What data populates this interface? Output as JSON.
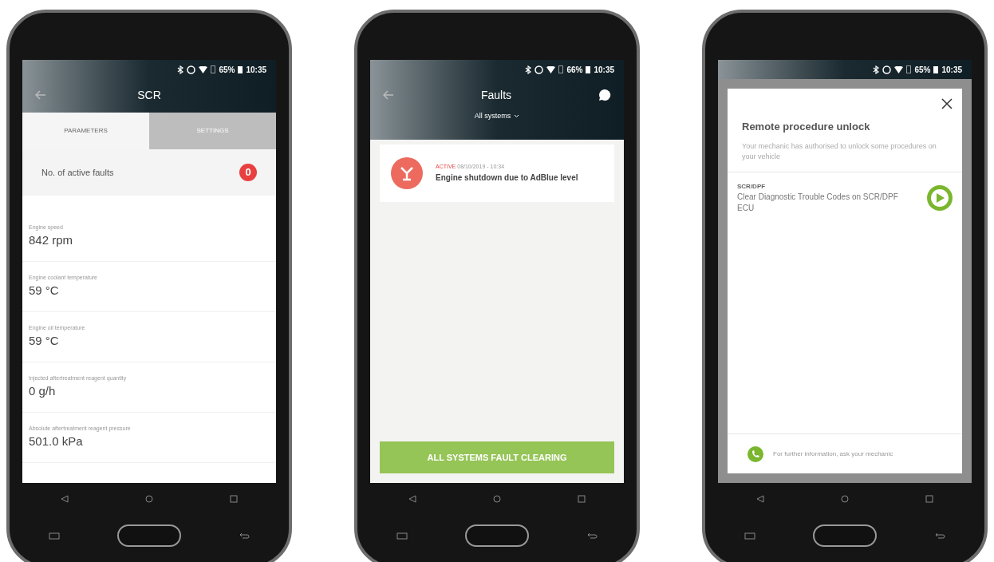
{
  "phones": [
    {
      "kind": "parameters",
      "status_bar": {
        "battery": "65%",
        "time": "10:35"
      },
      "title": "SCR",
      "tabs": [
        {
          "label": "PARAMETERS",
          "selected": true
        },
        {
          "label": "SETTINGS",
          "selected": false
        }
      ],
      "active_faults": {
        "label": "No. of active faults",
        "count": "0"
      },
      "parameters": [
        {
          "name": "Engine speed",
          "value": "842 rpm"
        },
        {
          "name": "Engine coolant temperature",
          "value": "59 °C"
        },
        {
          "name": "Engine oil temperature",
          "value": "59 °C"
        },
        {
          "name": "Injected aftertreatment reagent quantity",
          "value": "0 g/h"
        },
        {
          "name": "Absolute aftertreatment reagent pressure",
          "value": "501.0 kPa"
        }
      ]
    },
    {
      "kind": "faults",
      "status_bar": {
        "battery": "66%",
        "time": "10:35"
      },
      "title": "Faults",
      "filter": "All systems",
      "faults": [
        {
          "status": "ACTIVE",
          "timestamp": "08/10/2019 - 10:34",
          "description": "Engine shutdown due to AdBlue level"
        }
      ],
      "button": "ALL SYSTEMS FAULT CLEARING"
    },
    {
      "kind": "dialog",
      "status_bar": {
        "battery": "65%",
        "time": "10:35"
      },
      "dialog": {
        "title": "Remote procedure unlock",
        "subtitle": "Your mechanic has authorised to unlock some procedures on your vehicle",
        "procedures": [
          {
            "tag": "SCR/DPF",
            "name": "Clear Diagnostic Trouble Codes on SCR/DPF ECU"
          }
        ],
        "footer": "For further information, ask your mechanic"
      }
    }
  ]
}
